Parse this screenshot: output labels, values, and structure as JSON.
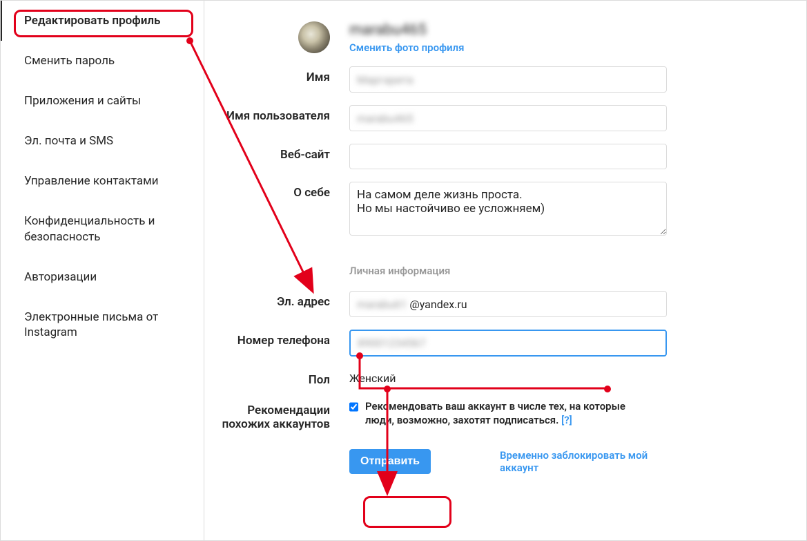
{
  "sidebar": {
    "items": [
      {
        "label": "Редактировать профиль",
        "active": true
      },
      {
        "label": "Сменить пароль",
        "active": false
      },
      {
        "label": "Приложения и сайты",
        "active": false
      },
      {
        "label": "Эл. почта и SMS",
        "active": false
      },
      {
        "label": "Управление контактами",
        "active": false
      },
      {
        "label": "Конфиденциальность и безопасность",
        "active": false
      },
      {
        "label": "Авторизации",
        "active": false
      },
      {
        "label": "Электронные письма от Instagram",
        "active": false
      }
    ]
  },
  "profile": {
    "username_blurred": "marabu465",
    "change_photo": "Сменить фото профиля",
    "labels": {
      "name": "Имя",
      "username": "Имя пользователя",
      "website": "Веб-сайт",
      "bio": "О себе",
      "private_section": "Личная информация",
      "email": "Эл. адрес",
      "phone": "Номер телефона",
      "gender": "Пол",
      "recommendations": "Рекомендации похожих аккаунтов"
    },
    "values": {
      "name_blurred": "Маргарита",
      "username_blurred": "marabu465",
      "website": "",
      "bio": "На самом деле жизнь проста.\nНо мы настойчиво ее усложняем)",
      "email_blurred": "marabu61",
      "email_suffix": "@yandex.ru",
      "phone_blurred": "89001234567",
      "gender": "Женский",
      "reco_checked": true,
      "reco_text": "Рекомендовать ваш аккаунт в числе тех, на которые люди, возможно, захотят подписаться.",
      "reco_help": "[?]"
    },
    "submit": "Отправить",
    "disable_link": "Временно заблокировать мой аккаунт"
  }
}
